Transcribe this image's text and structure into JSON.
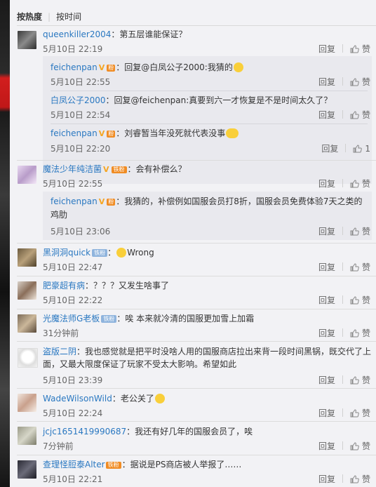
{
  "tabs": {
    "hot": "按热度",
    "time": "按时间"
  },
  "labels": {
    "reply": "回复",
    "like": "赞",
    "fans_badge": "粉",
    "iron_fan": "铁粉",
    "fan_club": "铁粉",
    "v": "V"
  },
  "comments": [
    {
      "user": "queenkiller2004",
      "text": "：第五层谁能保证？",
      "time": "5月10日 22:19",
      "likes": "赞",
      "subs": [
        {
          "user": "feichenpan",
          "text": "：回复@白凤公子2000:我猜的",
          "time": "5月10日 22:55",
          "likes": "赞"
        },
        {
          "user": "白凤公子2000",
          "text": "：回复@feichenpan:真要到六一才恢复是不是时间太久了？",
          "time": "5月10日 22:54",
          "likes": "赞"
        },
        {
          "user": "feichenpan",
          "text": "：刘睿暂当年没死就代表没事",
          "time": "5月10日 22:20",
          "likes": "1"
        }
      ]
    },
    {
      "user": "魔法少年纯洁菌",
      "text": "：会有补偿么？",
      "time": "5月10日 22:55",
      "likes": "赞",
      "subs": [
        {
          "user": "feichenpan",
          "text": "：我猜的，补偿例如国服会员打8折，国服会员免费体验7天之类的鸡肋",
          "time": "5月10日 23:06",
          "likes": "赞"
        }
      ]
    },
    {
      "user": "黑洞洞quick",
      "text": "Wrong",
      "time": "5月10日 22:47",
      "likes": "赞"
    },
    {
      "user": "肥豪超有病",
      "text": "：？？？又发生啥事了",
      "time": "5月10日 22:22",
      "likes": "赞"
    },
    {
      "user": "光魔法师G老板",
      "text": "：唉 本来就冷清的国服更加雪上加霜",
      "time": "31分钟前",
      "likes": "赞"
    },
    {
      "user": "盗版二阴",
      "text": "：我也感觉就是把平时没啥人用的国服商店拉出来背一段时间黑锅，既交代了上面，又最大限度保证了玩家不受太大影响。希望如此",
      "time": "5月10日 23:39",
      "likes": "赞"
    },
    {
      "user": "WadeWilsonWild",
      "text": "：老公关了",
      "time": "5月10日 22:24",
      "likes": "赞"
    },
    {
      "user": "jcjc1651419990687",
      "text": "：我还有好几年的国服会员了，唉",
      "time": "7分钟前",
      "likes": "赞"
    },
    {
      "user": "查理怪脰泰Alter",
      "text": "：据说是PS商店被人举报了……",
      "time": "5月10日 22:21",
      "likes": "赞"
    }
  ]
}
